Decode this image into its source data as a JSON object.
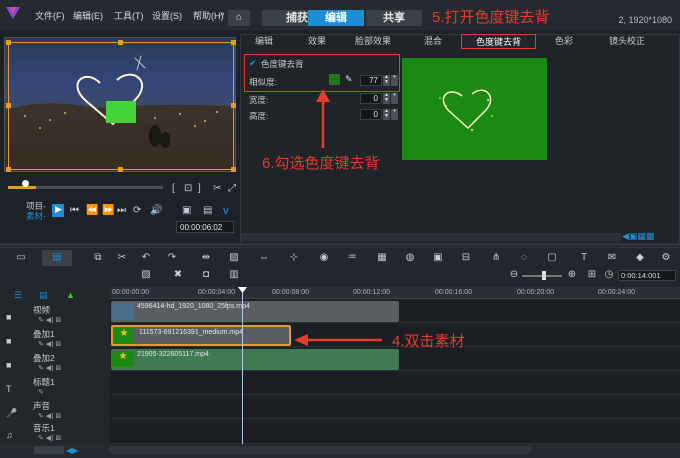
{
  "menu": [
    "文件(F)",
    "编辑(E)",
    "工具(T)",
    "设置(S)",
    "帮助(H)"
  ],
  "top_tabs": {
    "capture": "捕获",
    "edit": "编辑",
    "share": "共享"
  },
  "resolution": "2, 1920*1080",
  "annotations": {
    "step5": "5.打开色度键去背",
    "step6": "6.勾选色度键去背",
    "step4": "4.双击素材"
  },
  "preview": {
    "timecode": "00:00:06:02",
    "project_label": "项目-",
    "clip_label": "素材-",
    "format_label": "V"
  },
  "options_tabs": [
    "编辑",
    "效果",
    "脸部效果",
    "混合",
    "色度键去背",
    "色彩",
    "镜头校正"
  ],
  "chroma": {
    "checkbox_label": "色度键去背",
    "similarity_label": "相似度:",
    "similarity_value": "77",
    "width_label": "宽度:",
    "width_value": "0",
    "height_label": "高度:",
    "height_value": "0",
    "key_color": "#1a7a12"
  },
  "timeline": {
    "timecodes": [
      "00:00:00:00",
      "00:00:04:00",
      "00:00:08:00",
      "00:00:12:00",
      "00:00:16:00",
      "00:00:20:00",
      "00:00:24:00"
    ],
    "zoom_time": "0:00:14:001",
    "tracks": [
      "视频",
      "叠加1",
      "叠加2",
      "标题1",
      "声音",
      "音乐1"
    ],
    "clips": {
      "video": "4596414-hd_1920_1080_25fps.mp4",
      "overlay1": "111573-691216391_medium.mp4",
      "overlay2": "21905-322605117.mp4"
    }
  },
  "colors": {
    "accent": "#1d8ed4",
    "annotation": "#e43b2b",
    "selection": "#e59b2a"
  }
}
